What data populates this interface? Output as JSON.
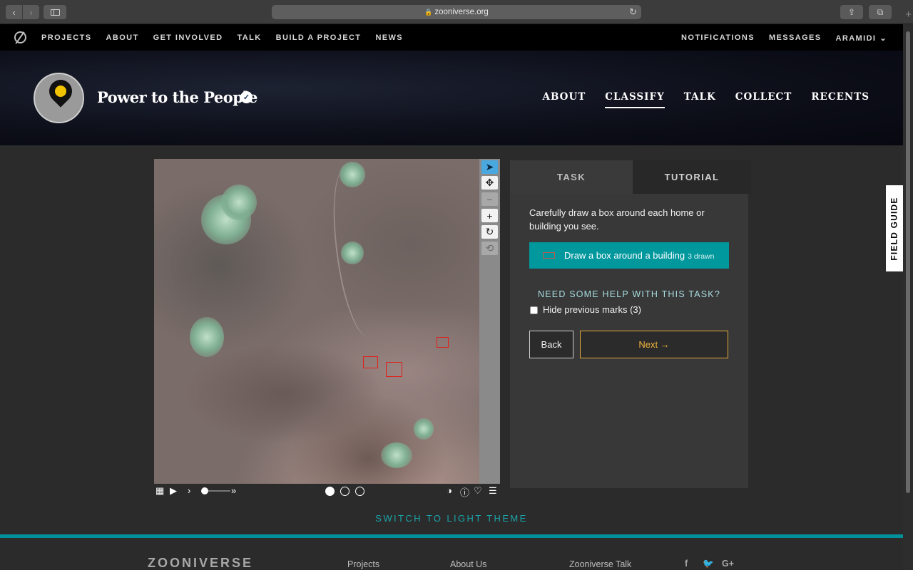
{
  "browser": {
    "url": "zooniverse.org",
    "back_icon": "chevron-left-icon",
    "forward_icon": "chevron-right-icon"
  },
  "topnav": {
    "left": [
      "PROJECTS",
      "ABOUT",
      "GET INVOLVED",
      "TALK",
      "BUILD A PROJECT",
      "NEWS"
    ],
    "right": [
      "NOTIFICATIONS",
      "MESSAGES",
      "ARAMIDI"
    ]
  },
  "project": {
    "title": "Power to the People",
    "nav": [
      "ABOUT",
      "CLASSIFY",
      "TALK",
      "COLLECT",
      "RECENTS"
    ],
    "active_nav": "CLASSIFY"
  },
  "task_panel": {
    "tabs": [
      "TASK",
      "TUTORIAL"
    ],
    "question": "Carefully draw a box around each home or building you see.",
    "tool_label": "Draw a box around a building",
    "tool_count": "3 drawn",
    "help": "NEED SOME HELP WITH THIS TASK?",
    "hide_marks": "Hide previous marks (3)",
    "back": "Back",
    "next": "Next →"
  },
  "field_guide": "FIELD GUIDE",
  "theme_toggle": "SWITCH TO LIGHT THEME",
  "footer": {
    "brand": "ZOONIVERSE",
    "links": [
      "Projects",
      "About Us",
      "Zooniverse Talk"
    ],
    "social": [
      "f",
      "🐦",
      "G+"
    ]
  },
  "colors": {
    "accent_teal": "#00979d",
    "next_gold": "#f0b43c",
    "mark_red": "#e0201a",
    "active_tool_blue": "#4aa8e0"
  }
}
